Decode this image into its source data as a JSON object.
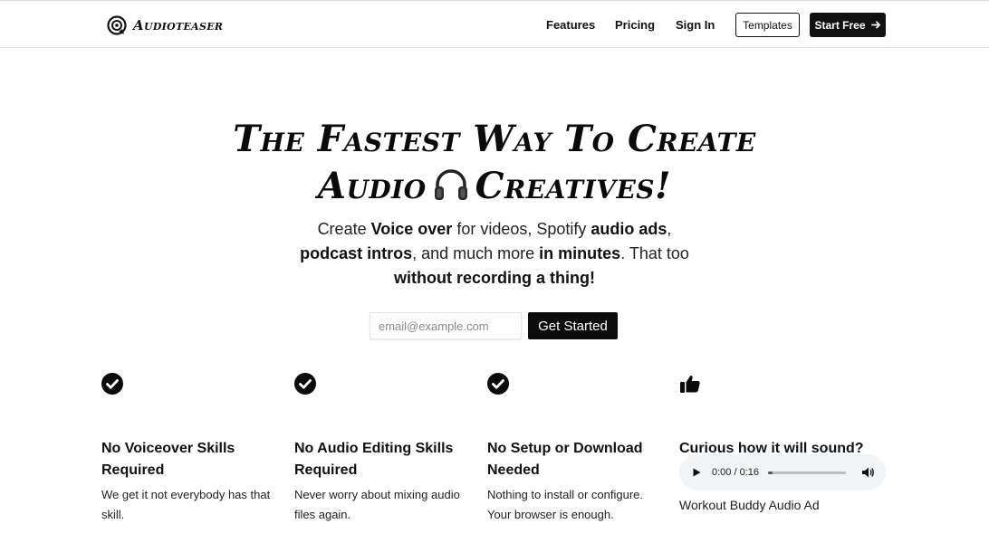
{
  "brand": {
    "name": "Audioteaser",
    "icon": "audioteaser-logo-icon"
  },
  "nav": {
    "features": "Features",
    "pricing": "Pricing",
    "sign_in": "Sign In",
    "templates": "Templates",
    "start_free": "Start Free",
    "start_free_icon": "arrow-right-icon"
  },
  "hero": {
    "title_line1": "The Fastest Way To Create",
    "title_line2_a": "Audio",
    "title_emoji": "headphones-icon",
    "title_line2_b": "Creatives!",
    "subtitle": {
      "t1": "Create ",
      "b1": "Voice over",
      "t2": " for videos, Spotify ",
      "b2": "audio ads",
      "t3": ", ",
      "b3": "podcast intros",
      "t4": ", and much more ",
      "b4": "in minutes",
      "t5": ". That too ",
      "b5": "without recording a thing!"
    }
  },
  "signup": {
    "email_placeholder": "email@example.com",
    "email_value": "",
    "button": "Get Started"
  },
  "features": [
    {
      "icon": "check-circle-icon",
      "title": "No Voiceover Skills Required",
      "desc": "We get it not everybody has that skill."
    },
    {
      "icon": "check-circle-icon",
      "title": "No Audio Editing Skills Required",
      "desc": "Never worry about mixing audio files again."
    },
    {
      "icon": "check-circle-icon",
      "title": "No Setup or Download Needed",
      "desc": "Nothing to install or configure. Your browser is enough."
    },
    {
      "icon": "thumbs-up-icon",
      "title": "Curious how it will sound?"
    }
  ],
  "audio": {
    "time": "0:00 / 0:16",
    "progress_fraction": 0.06,
    "caption": "Workout Buddy Audio Ad"
  },
  "colors": {
    "text": "#111111",
    "button_bg": "#0c0c0c",
    "player_bg": "#f1f3f4"
  }
}
